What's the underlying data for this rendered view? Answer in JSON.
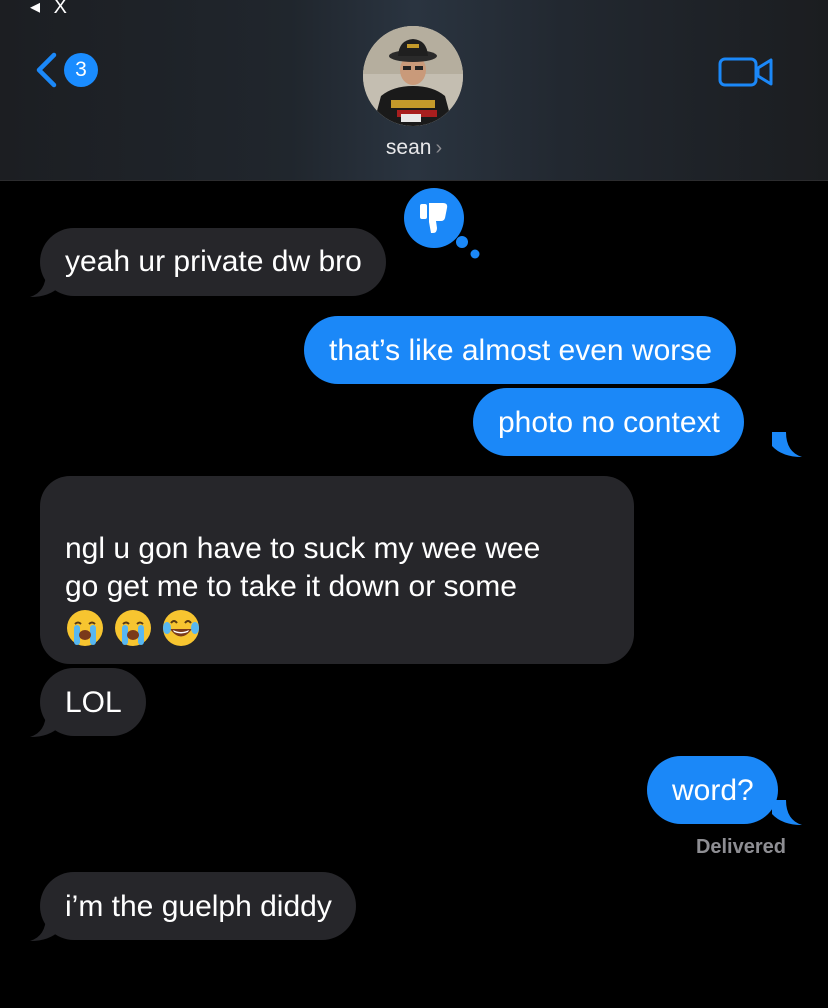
{
  "header": {
    "status_remnant": "◂ X",
    "back_badge_count": "3",
    "contact_name": "sean",
    "contact_chevron": "›",
    "icons": [
      "chevron-left-icon",
      "video-camera-icon"
    ]
  },
  "messages": [
    {
      "direction": "incoming",
      "text": "yeah ur private dw bro",
      "reaction": "thumbs-down-icon"
    },
    {
      "direction": "outgoing",
      "text": "that’s like almost even worse"
    },
    {
      "direction": "outgoing",
      "text": "photo no context"
    },
    {
      "direction": "incoming",
      "text_line1": "ngl u gon have to suck my wee wee",
      "text_line2": "go get me to take it down or some",
      "emojis": [
        "loudly-crying-face-icon",
        "loudly-crying-face-icon",
        "tears-of-joy-face-icon"
      ]
    },
    {
      "direction": "incoming",
      "text": "LOL"
    },
    {
      "direction": "outgoing",
      "text": "word?",
      "status": "Delivered"
    },
    {
      "direction": "incoming",
      "text": "i’m the guelph diddy"
    }
  ],
  "colors": {
    "accent": "#1b88f8",
    "incoming_bubble": "#26262a",
    "background": "#000000",
    "status_text": "#8e8e93"
  }
}
